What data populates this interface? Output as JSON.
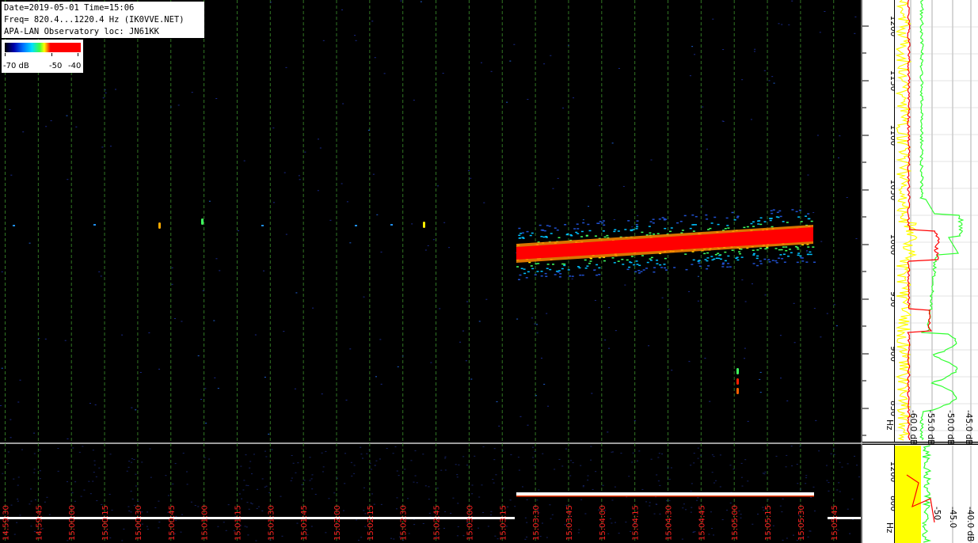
{
  "header": {
    "line1": "Date=2019-05-01 Time=15:06",
    "line2": "Freq= 820.4...1220.4 Hz (IK0VVE.NET)",
    "line3": "APA-LAN Observatory loc: JN61KK"
  },
  "legend": {
    "min_label": "-70 dB",
    "mid_label": "-50",
    "max_label": "-40"
  },
  "freq_axis": {
    "unit": "Hz",
    "ticks": [
      "1200",
      "1150",
      "1100",
      "1050",
      "1000",
      "950",
      "900",
      "850"
    ]
  },
  "spectrum_axis": {
    "labels": [
      "-45.0 dB",
      "-50.0 dB",
      "-55.0 dB",
      "-60.0 dB"
    ]
  },
  "lower_freq_axis": {
    "unit": "Hz",
    "ticks": [
      "1200",
      "800"
    ]
  },
  "lower_spectrum_axis": {
    "labels": [
      "-40.0 dB",
      "-45.0",
      "-50"
    ]
  },
  "time_labels": [
    "14:59:30",
    "14:59:45",
    "15:00:00",
    "15:00:15",
    "15:00:30",
    "15:00:45",
    "15:01:00",
    "15:01:15",
    "15:01:30",
    "15:01:45",
    "15:02:00",
    "15:02:15",
    "15:02:30",
    "15:02:45",
    "15:03:00",
    "15:03:15",
    "15:03:30",
    "15:03:45",
    "15:04:00",
    "15:04:15",
    "15:04:30",
    "15:04:45",
    "15:05:00",
    "15:05:15",
    "15:05:30",
    "15:05:45"
  ],
  "colors": {
    "background": "#000000",
    "grid": "#3a8a2a",
    "signal_core": "#ff0000",
    "time_label": "#ff2020",
    "spectrum_yellow": "#ffff00",
    "spectrum_green": "#30ff30",
    "spectrum_red": "#ff0000"
  }
}
